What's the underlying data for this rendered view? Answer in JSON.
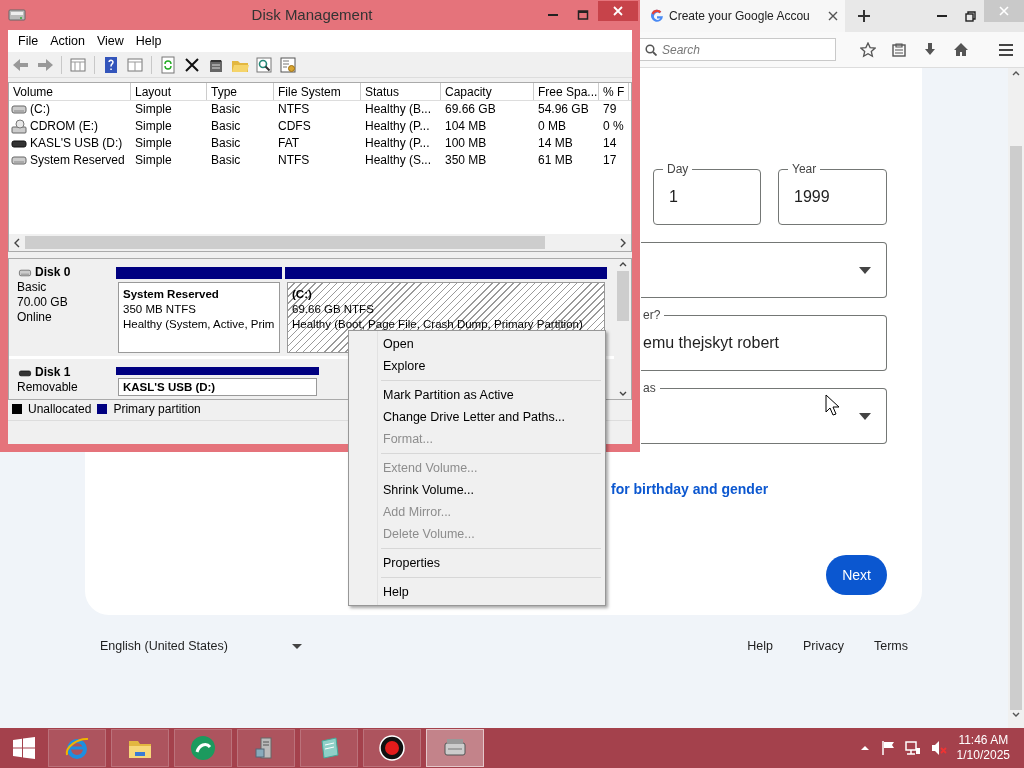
{
  "browser": {
    "tab": {
      "title": "Create your Google Accou"
    },
    "search": {
      "placeholder": "Search"
    },
    "date_fields": [
      {
        "label": "Day",
        "value": "1"
      },
      {
        "label": "Year",
        "value": "1999"
      }
    ],
    "fields": [
      {
        "kind": "select"
      },
      {
        "kind": "text",
        "label": "er?",
        "value": "emu thejskyt robert"
      },
      {
        "kind": "select",
        "label": "as"
      }
    ],
    "link": "for birthday and gender",
    "next_button": "Next",
    "footer": {
      "language": "English (United States)",
      "links": [
        "Help",
        "Privacy",
        "Terms"
      ]
    }
  },
  "disk_management": {
    "title": "Disk Management",
    "menu": [
      "File",
      "Action",
      "View",
      "Help"
    ],
    "columns": [
      "Volume",
      "Layout",
      "Type",
      "File System",
      "Status",
      "Capacity",
      "Free Spa...",
      "% F"
    ],
    "volumes": [
      {
        "kind": "hdd",
        "cells": [
          "(C:)",
          "Simple",
          "Basic",
          "NTFS",
          "Healthy (B...",
          "69.66 GB",
          "54.96 GB",
          "79"
        ]
      },
      {
        "kind": "cdrom",
        "cells": [
          "CDROM (E:)",
          "Simple",
          "Basic",
          "CDFS",
          "Healthy (P...",
          "104 MB",
          "0 MB",
          "0 %"
        ]
      },
      {
        "kind": "usb",
        "cells": [
          "KASL'S USB (D:)",
          "Simple",
          "Basic",
          "FAT",
          "Healthy (P...",
          "100 MB",
          "14 MB",
          "14"
        ]
      },
      {
        "kind": "hdd",
        "cells": [
          "System Reserved",
          "Simple",
          "Basic",
          "NTFS",
          "Healthy (S...",
          "350 MB",
          "61 MB",
          "17"
        ]
      }
    ],
    "disks": [
      {
        "kind": "hdd",
        "name": "Disk 0",
        "info": [
          "Basic",
          "70.00 GB",
          "Online"
        ],
        "partitions": [
          {
            "name": "System Reserved",
            "size": "350 MB NTFS",
            "status": "Healthy (System, Active, Prim",
            "selected": false
          },
          {
            "name": "(C:)",
            "size": "69.66 GB NTFS",
            "status": "Healthy (Boot, Page File, Crash Dump, Primary Partition)",
            "selected": true
          }
        ]
      },
      {
        "kind": "usb",
        "name": "Disk 1",
        "info": [
          "Removable"
        ],
        "partitions": [
          {
            "name": "KASL'S USB (D:)",
            "selected": false
          }
        ]
      }
    ],
    "legend": [
      {
        "label": "Unallocated",
        "color": "#000000"
      },
      {
        "label": "Primary partition",
        "color": "#000080"
      }
    ]
  },
  "context_menu": {
    "groups": [
      [
        {
          "label": "Open",
          "disabled": false
        },
        {
          "label": "Explore",
          "disabled": false
        }
      ],
      [
        {
          "label": "Mark Partition as Active",
          "disabled": false
        },
        {
          "label": "Change Drive Letter and Paths...",
          "disabled": false
        },
        {
          "label": "Format...",
          "disabled": true
        }
      ],
      [
        {
          "label": "Extend Volume...",
          "disabled": true
        },
        {
          "label": "Shrink Volume...",
          "disabled": false
        },
        {
          "label": "Add Mirror...",
          "disabled": true
        },
        {
          "label": "Delete Volume...",
          "disabled": true
        }
      ],
      [
        {
          "label": "Properties",
          "disabled": false
        }
      ],
      [
        {
          "label": "Help",
          "disabled": false
        }
      ]
    ]
  },
  "taskbar": {
    "apps": [
      {
        "kind": "browser",
        "active": false
      },
      {
        "kind": "folder",
        "active": false
      },
      {
        "kind": "circle",
        "active": false
      },
      {
        "kind": "computer",
        "active": false
      },
      {
        "kind": "notepad",
        "active": false
      },
      {
        "kind": "record",
        "active": false
      },
      {
        "kind": "drive",
        "active": true
      }
    ],
    "time": "11:46 AM",
    "date": "1/10/2025"
  }
}
